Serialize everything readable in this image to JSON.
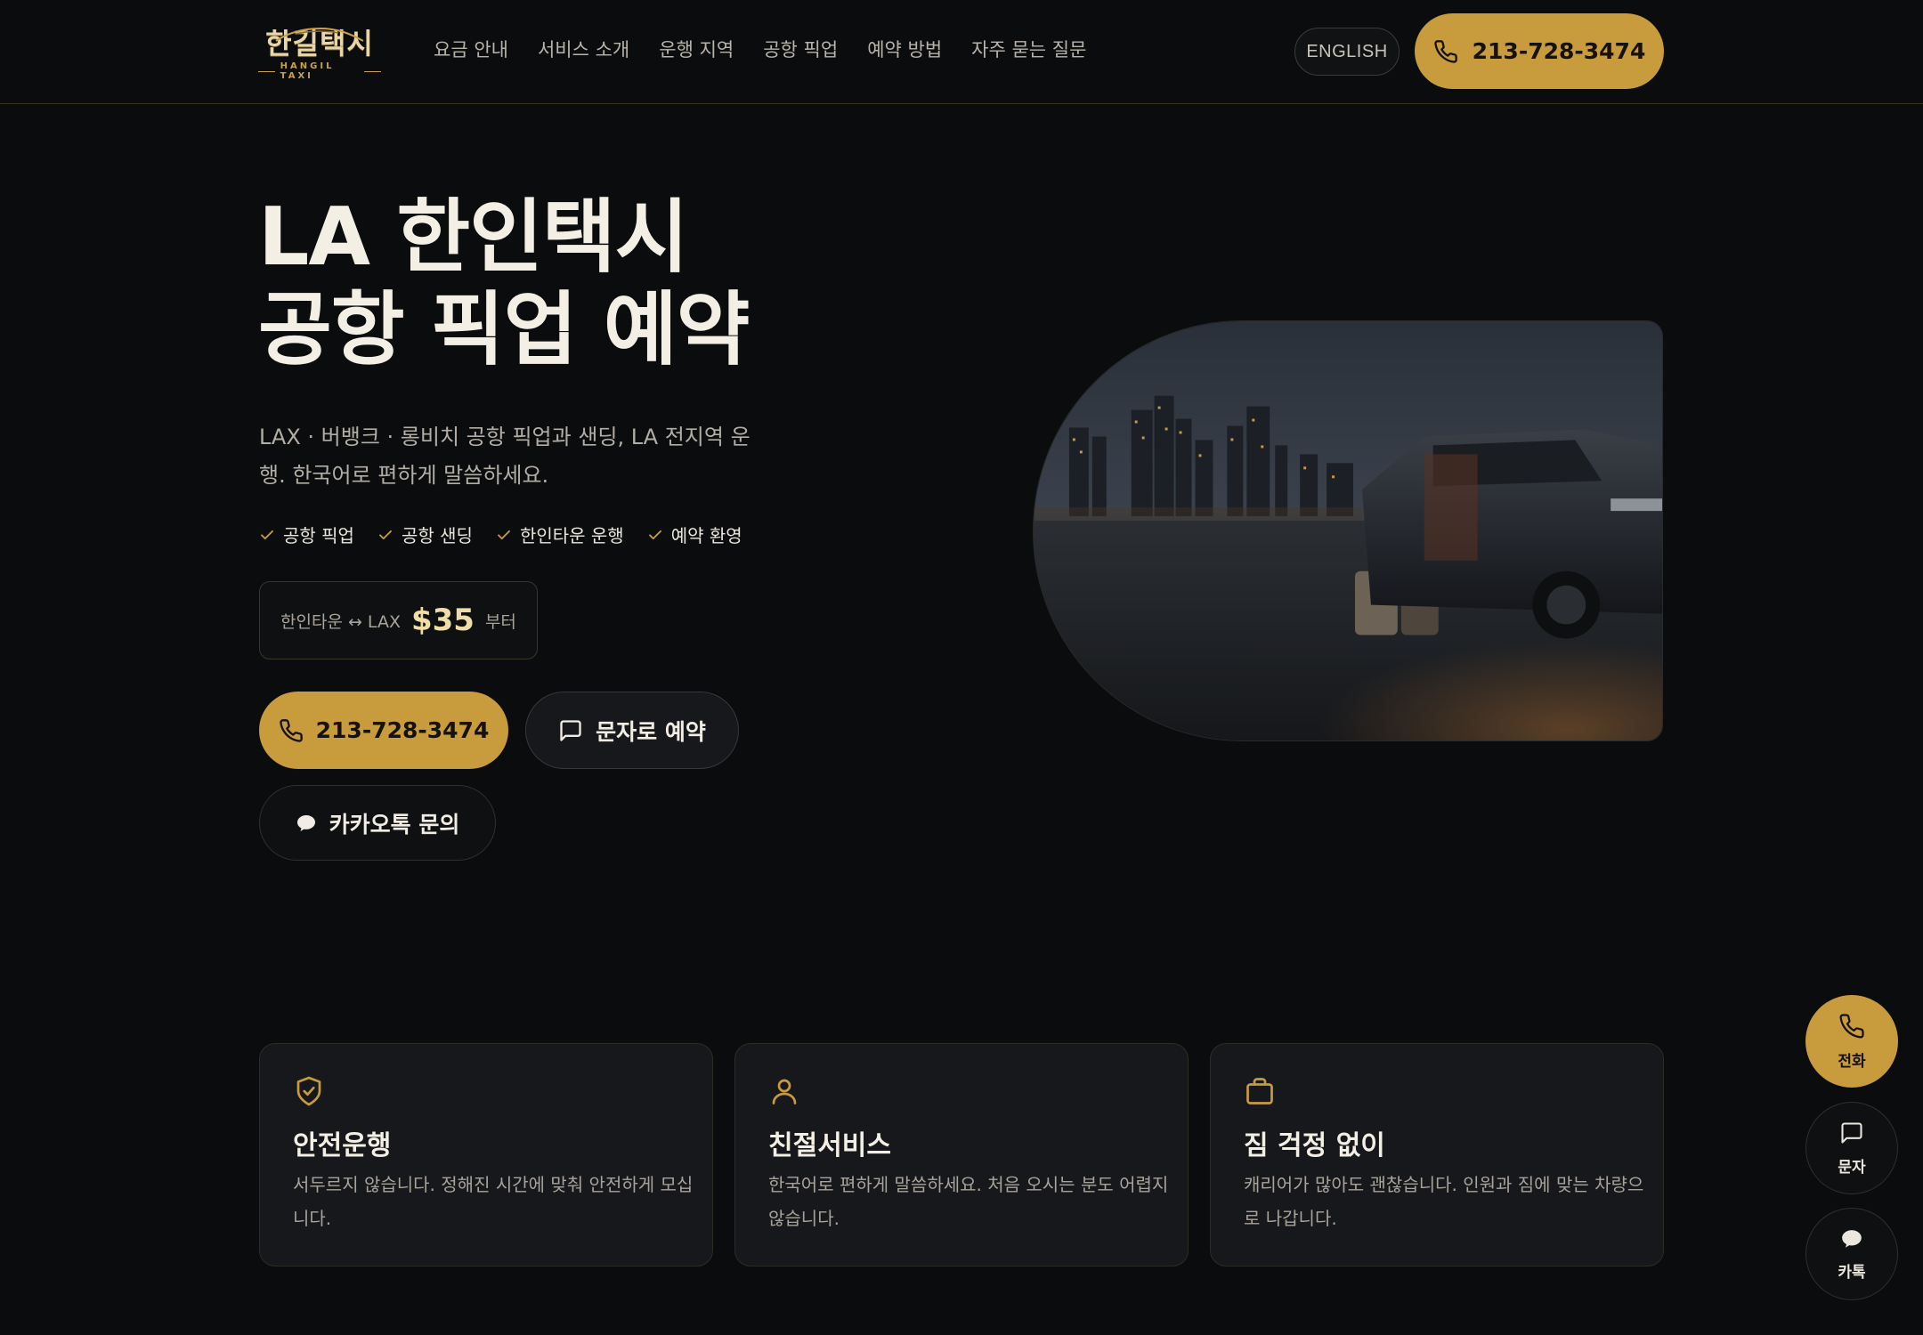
{
  "brand": {
    "logo_main": "한길택시",
    "logo_sub": "HANGIL TAXI",
    "accent": "#c89b3c",
    "background": "#0b0c0e"
  },
  "nav": {
    "items": [
      {
        "label": "요금 안내"
      },
      {
        "label": "서비스 소개"
      },
      {
        "label": "운행 지역"
      },
      {
        "label": "공항 픽업"
      },
      {
        "label": "예약 방법"
      },
      {
        "label": "자주 묻는 질문"
      }
    ],
    "language_label": "ENGLISH",
    "phone_label": "213-728-3474",
    "phone_icon": "phone-icon"
  },
  "hero": {
    "title_line1": "LA 한인택시",
    "title_line2": "공항 픽업 예약",
    "description": "LAX · 버뱅크 · 롱비치 공항 픽업과 샌딩, LA 전지역 운행. 한국어로 편하게 말씀하세요.",
    "features": [
      {
        "label": "공항 픽업",
        "icon": "check-icon"
      },
      {
        "label": "공항 샌딩",
        "icon": "check-icon"
      },
      {
        "label": "한인타운 운행",
        "icon": "check-icon"
      },
      {
        "label": "예약 환영",
        "icon": "check-icon"
      }
    ],
    "price": {
      "route": "한인타운 ↔ LAX",
      "value": "$35",
      "suffix": "부터"
    },
    "buttons": {
      "call_label": "213-728-3474",
      "sms_label": "문자로 예약",
      "kakao_label": "카카오톡 문의"
    },
    "image_alt_icon": "van-at-airport-image"
  },
  "cards": [
    {
      "icon": "shield-check-icon",
      "title": "안전운행",
      "text": "서두르지 않습니다. 정해진 시간에 맞춰 안전하게 모십니다."
    },
    {
      "icon": "user-icon",
      "title": "친절서비스",
      "text": "한국어로 편하게 말씀하세요. 처음 오시는 분도 어렵지 않습니다."
    },
    {
      "icon": "briefcase-icon",
      "title": "짐 걱정 없이",
      "text": "캐리어가 많아도 괜찮습니다. 인원과 짐에 맞는 차량으로 나갑니다."
    }
  ],
  "floating": {
    "call_label": "전화",
    "sms_label": "문자",
    "kakao_label": "카톡"
  }
}
